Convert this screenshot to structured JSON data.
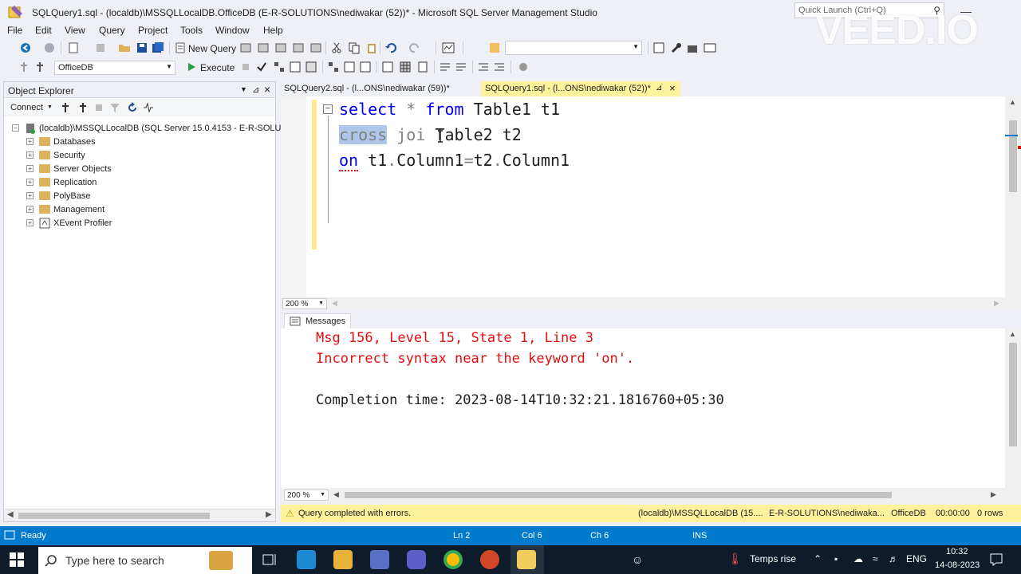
{
  "window": {
    "title": "SQLQuery1.sql - (localdb)\\MSSQLLocalDB.OfficeDB (E-R-SOLUTIONS\\nediwakar (52))* - Microsoft SQL Server Management Studio",
    "quick_launch_placeholder": "Quick Launch (Ctrl+Q)",
    "watermark": "VEED.IO"
  },
  "menu": [
    "File",
    "Edit",
    "View",
    "Query",
    "Project",
    "Tools",
    "Window",
    "Help"
  ],
  "toolbar": {
    "new_query_label": "New Query",
    "database_value": "OfficeDB",
    "execute_label": "Execute"
  },
  "object_explorer": {
    "title": "Object Explorer",
    "connect_label": "Connect",
    "server": "(localdb)\\MSSQLLocalDB (SQL Server 15.0.4153 - E-R-SOLUT",
    "items": [
      {
        "label": "Databases",
        "icon": "folder-icon"
      },
      {
        "label": "Security",
        "icon": "folder-icon"
      },
      {
        "label": "Server Objects",
        "icon": "folder-icon"
      },
      {
        "label": "Replication",
        "icon": "folder-icon"
      },
      {
        "label": "PolyBase",
        "icon": "folder-icon"
      },
      {
        "label": "Management",
        "icon": "folder-icon"
      },
      {
        "label": "XEvent Profiler",
        "icon": "profiler-icon"
      }
    ]
  },
  "tabs": [
    {
      "label": "SQLQuery2.sql - (l...ONS\\nediwakar (59))*",
      "active": false
    },
    {
      "label": "SQLQuery1.sql - (l...ONS\\nediwakar (52))*",
      "active": true
    }
  ],
  "editor": {
    "line1": {
      "kw1": "select",
      "star": "*",
      "kw2": "from",
      "rest": "Table1 t1"
    },
    "line2": {
      "sel": "cross",
      "gray": " joi",
      "rest": " Table2 t2"
    },
    "line3": {
      "kw": "on",
      "a": " t1",
      "d1": ".",
      "b": "Column1",
      "eq": "=",
      "c": "t2",
      "d2": ".",
      "e": "Column1"
    },
    "zoom": "200 %"
  },
  "results": {
    "tab_label": "Messages",
    "lines": [
      "Msg 156, Level 15, State 1, Line 3",
      "Incorrect syntax near the keyword 'on'.",
      "Completion time: 2023-08-14T10:32:21.1816760+05:30"
    ],
    "zoom": "200 %"
  },
  "query_status": {
    "message": "Query completed with errors.",
    "server": "(localdb)\\MSSQLLocalDB (15....",
    "user": "E-R-SOLUTIONS\\nediwaka...",
    "database": "OfficeDB",
    "elapsed": "00:00:00",
    "rows": "0 rows"
  },
  "statusbar": {
    "ready": "Ready",
    "ln": "Ln 2",
    "col": "Col 6",
    "ch": "Ch 6",
    "ins": "INS"
  },
  "taskbar": {
    "search_placeholder": "Type here to search",
    "weather": "Temps rise",
    "lang": "ENG",
    "time": "10:32",
    "date": "14-08-2023"
  },
  "colors": {
    "accent": "#007acc",
    "tab_active": "#fff29d",
    "error": "#e01010",
    "keyword": "#0000ff"
  }
}
